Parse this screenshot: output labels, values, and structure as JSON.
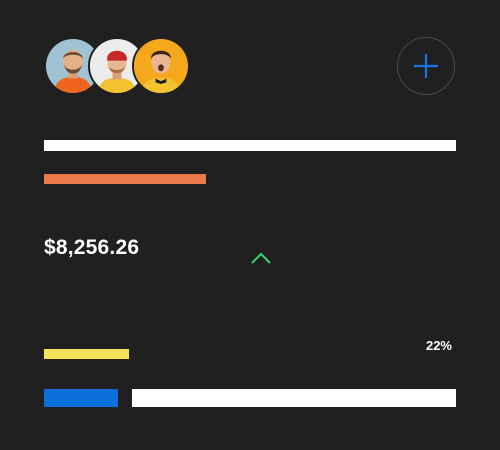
{
  "amount": "$8,256.26",
  "percent": "22%",
  "icons": {
    "add": "plus-icon",
    "trend": "chevron-up-icon"
  },
  "colors": {
    "background": "#202020",
    "orange": "#ea7a4a",
    "yellow": "#f6e35a",
    "blue": "#0a6edc",
    "trend_green": "#3bd46a",
    "plus_blue": "#1b74e4"
  },
  "progress": {
    "value_percent": 22
  }
}
